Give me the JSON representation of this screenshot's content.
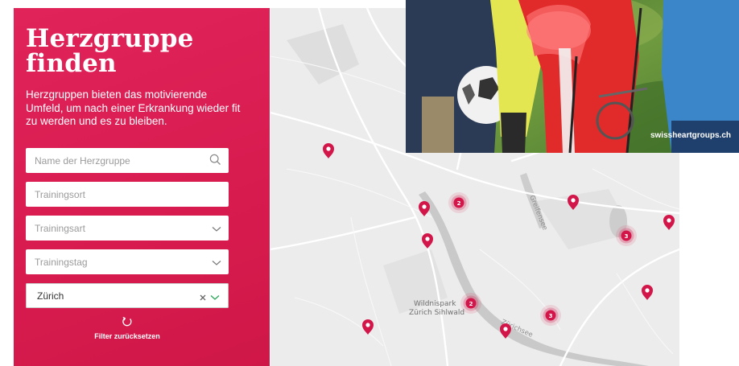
{
  "sidebar": {
    "title": "Herzgruppe finden",
    "intro": "Herzgruppen bieten das motivierende Umfeld, um nach einer Erkrankung wieder fit zu werden und es zu bleiben.",
    "search_placeholder": "Name der Herzgruppe",
    "location_placeholder": "Trainingsort",
    "type_placeholder": "Trainingsart",
    "day_placeholder": "Trainingstag",
    "region_value": "Zürich",
    "reset_label": "Filter zurücksetzen"
  },
  "map": {
    "labels": {
      "greifensee": "Greifensee",
      "wildnispark": "Wildnispark",
      "sihlwald": "Zürich Sihlwald",
      "zurichsee": "Zürichsee"
    },
    "clusters": [
      {
        "count": "2"
      },
      {
        "count": "3"
      },
      {
        "count": "2"
      },
      {
        "count": "3"
      }
    ]
  },
  "photo": {
    "caption": "swissheartgroups.ch"
  },
  "colors": {
    "brand": "#d81b4f",
    "map_bg": "#ececec",
    "marker": "#d3164a"
  }
}
